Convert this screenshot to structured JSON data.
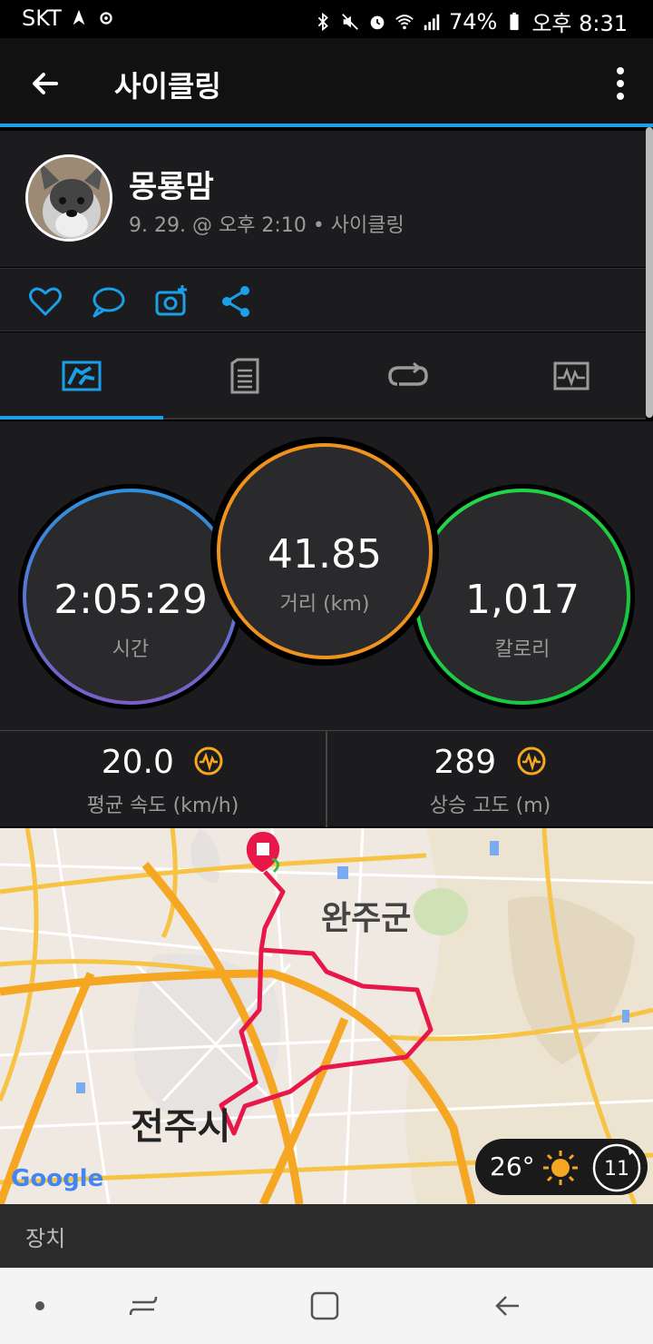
{
  "status_bar": {
    "carrier": "SKT",
    "battery": "74%",
    "time": "오후 8:31"
  },
  "app_bar": {
    "title": "사이클링",
    "back_icon": "arrow-left-icon",
    "more_icon": "more-vert-icon"
  },
  "activity": {
    "user_name": "몽룡맘",
    "meta": "9. 29. @ 오후 2:10 • 사이클링"
  },
  "actions": [
    {
      "icon": "heart-icon"
    },
    {
      "icon": "comment-icon"
    },
    {
      "icon": "add-photo-icon"
    },
    {
      "icon": "share-icon"
    }
  ],
  "tabs": [
    {
      "icon": "summary-icon",
      "selected": true
    },
    {
      "icon": "details-icon",
      "selected": false
    },
    {
      "icon": "laps-icon",
      "selected": false
    },
    {
      "icon": "charts-icon",
      "selected": false
    }
  ],
  "stats": {
    "time": {
      "value": "2:05:29",
      "label": "시간"
    },
    "distance": {
      "value": "41.85",
      "label": "거리 (km)"
    },
    "calories": {
      "value": "1,017",
      "label": "칼로리"
    }
  },
  "colors": {
    "accent": "#1aa0e8",
    "time_ring_top": "#2f8fe0",
    "time_ring_bottom": "#7b5fc6",
    "distance_ring": "#f0921e",
    "calories_ring": "#27d84f",
    "route": "#e8174a",
    "badge": "#f5a623"
  },
  "substats": {
    "avg_speed": {
      "value": "20.0",
      "label": "평균 속도 (km/h)"
    },
    "elevation": {
      "value": "289",
      "label": "상승 고도 (m)"
    }
  },
  "map": {
    "labels": {
      "wanju": "완주군",
      "jeonju": "전주시"
    },
    "google_logo": "Google",
    "weather_temp": "26°",
    "weather_icon": "sun-icon",
    "wind": "11"
  },
  "device_section": {
    "label": "장치"
  }
}
